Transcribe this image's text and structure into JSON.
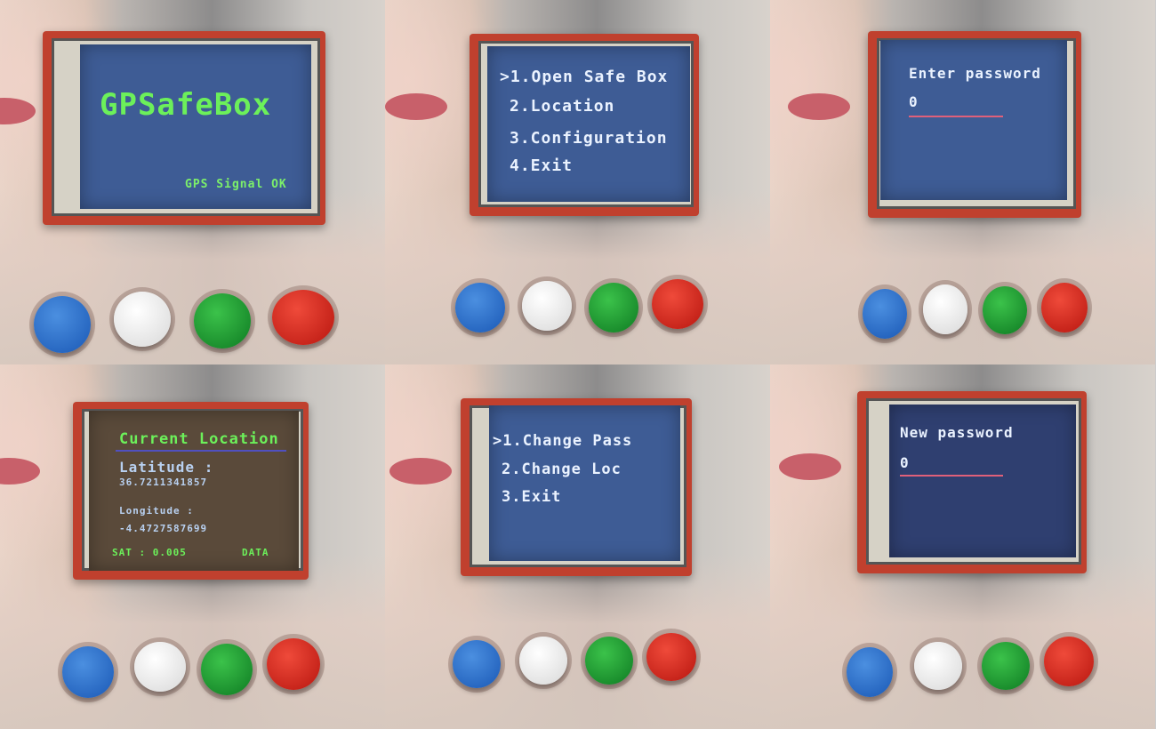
{
  "panels": [
    {
      "title": "GPSafeBox",
      "status": "GPS Signal OK"
    },
    {
      "menu": [
        ">1.Open Safe Box",
        "2.Location",
        "3.Configuration",
        "4.Exit"
      ]
    },
    {
      "prompt": "Enter password",
      "value": "0"
    },
    {
      "title": "Current Location",
      "latitude_label": "Latitude   :",
      "latitude": "36.7211341857",
      "longitude_label": "Longitude :",
      "longitude": "-4.4727587699",
      "sat": "SAT : 0.005",
      "data": "DATA"
    },
    {
      "menu": [
        ">1.Change Pass",
        "2.Change Loc",
        "3.Exit"
      ]
    },
    {
      "prompt": "New password",
      "value": "0"
    }
  ],
  "buttons": [
    "blue",
    "white",
    "green",
    "red"
  ],
  "colors": {
    "screen_blue": "#3e5c95",
    "screen_brown": "#5a4a3a",
    "text_green": "#6cf05a",
    "text_white": "#eaf2ff"
  }
}
